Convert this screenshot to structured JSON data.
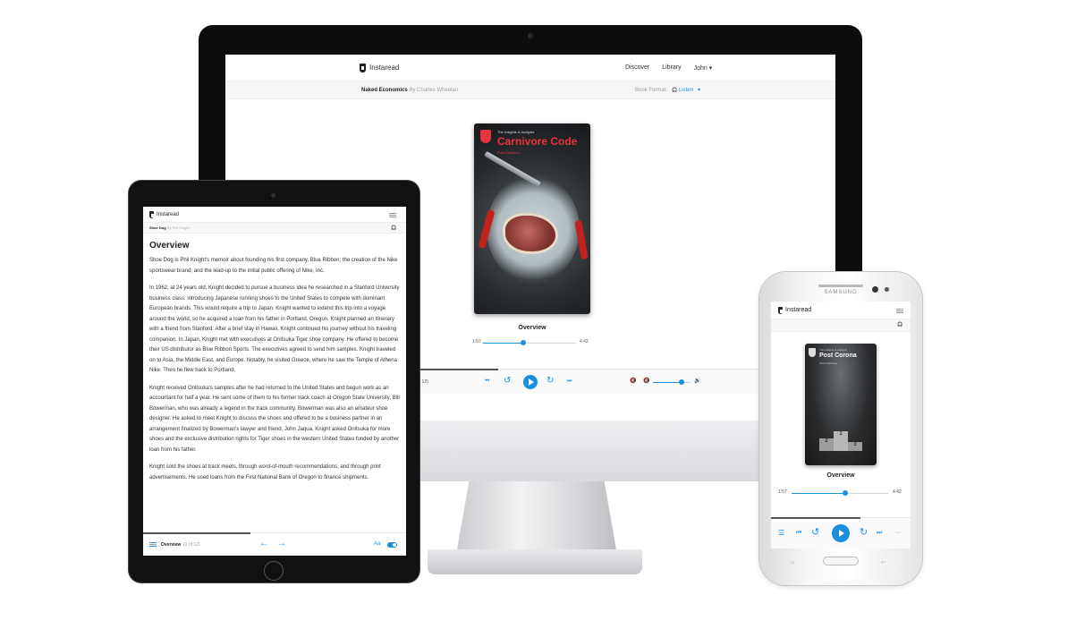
{
  "desktop": {
    "brand": "Instaread",
    "nav": [
      "Discover",
      "Library",
      "John ▾"
    ],
    "book_title": "Naked Economics",
    "book_author": "By Charles Wheelan",
    "format_label": "Book Format:",
    "format_value": "Listen",
    "format_chevron": "▾",
    "cover": {
      "series": "The Insights & Analysis",
      "title": "Carnivore Code",
      "author": "Paul Saladino"
    },
    "section": "Overview",
    "time_elapsed": "1:57",
    "time_total": "4:42",
    "progress": 0.42,
    "volume": 0.78,
    "player_page": "of 12)",
    "icons": {
      "skip_back": "⏮",
      "rewind": "↺",
      "forward": "↻",
      "skip_next": "⏭",
      "mute": "🔇",
      "volume": "🔊"
    }
  },
  "tablet": {
    "brand": "Instaread",
    "book_title": "Shoe Dog",
    "book_author": "By Phil Knight",
    "heading": "Overview",
    "paragraphs": [
      "Shoe Dog is Phil Knight's memoir about founding his first company, Blue Ribbon; the creation of the Nike sportswear brand; and the lead-up to the initial public offering of Nike, Inc.",
      "In 1962, at 24 years old, Knight decided to pursue a business idea he researched in a Stanford University business class: introducing Japanese running shoes to the United States to compete with dominant European brands. This would require a trip to Japan. Knight wanted to extend this trip into a voyage around the world, so he acquired a loan from his father in Portland, Oregon. Knight planned an itinerary with a friend from Stanford. After a brief stay in Hawaii, Knight continued his journey without his traveling companion. In Japan, Knight met with executives at Onitsuka Tiger shoe company. He offered to become their US distributor as Blue Ribbon Sports. The executives agreed to send him samples. Knight traveled on to Asia, the Middle East, and Europe. Notably, he visited Greece, where he saw the Temple of Athena Nike. Then he flew back to Portland.",
      "Knight received Onitsuka's samples after he had returned to the United States and begun work as an accountant for half a year. He sent some of them to his former track coach at Oregon State University, Bill Bowerman, who was already a legend in the track community. Bowerman was also an amateur shoe designer. He asked to meet Knight to discuss the shoes and offered to be a business partner in an arrangement finalized by Bowerman's lawyer and friend, John Jaqua. Knight asked Onitsuka for more shoes and the exclusive distribution rights for Tiger shoes in the western United States funded by another loan from his father.",
      "Knight sold the shoes at track meets, through word-of-mouth recommendations, and through print advertisements. He used loans from the First National Bank of Oregon to finance shipments."
    ],
    "footer_section": "Overview",
    "footer_page": "(1 of 12)",
    "font_label": "Aa",
    "icons": {
      "prev": "←",
      "next": "→",
      "listen": "🎧"
    }
  },
  "phone": {
    "maker": "SAMSUNG",
    "brand": "Instaread",
    "cover": {
      "series": "The Insights & Analysis",
      "title": "Post Corona",
      "author": "Scott Galloway",
      "podium": [
        "1",
        "2",
        "3"
      ]
    },
    "section": "Overview",
    "time_elapsed": "1:57",
    "time_total": "4:42",
    "progress": 0.55,
    "icons": {
      "list": "☰",
      "skip_back": "⏮",
      "rewind": "↺",
      "forward": "↻",
      "skip_next": "⏭",
      "more": "···",
      "listen": "🎧"
    }
  },
  "colors": {
    "accent": "#1a8fe0",
    "cover_red": "#e8323c"
  }
}
